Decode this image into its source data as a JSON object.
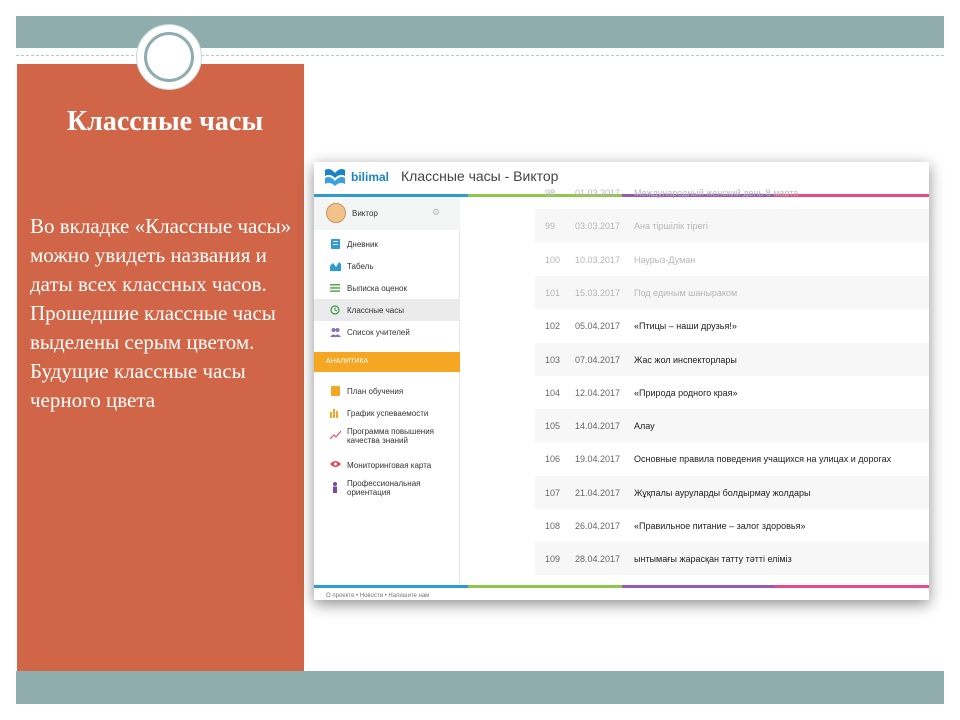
{
  "slide": {
    "title": "Классные часы",
    "body": "Во вкладке «Классные часы» можно увидеть названия и даты всех классных часов. Прошедшие классные часы выделены серым цветом. Будущие классные часы черного цвета"
  },
  "colors": {
    "frame_bar": "#8fadad",
    "left_panel": "#d06548",
    "analytics_band": "#f5a623",
    "brand": "#1c84c6"
  },
  "app": {
    "logo_text": "bilimal",
    "title": "Классные часы - Виктор",
    "user": {
      "name": "Виктор",
      "avatar_icon": "avatar",
      "settings_icon": "gear-icon"
    },
    "nav_items": [
      {
        "label": "Дневник",
        "icon": "diary-icon",
        "active": false
      },
      {
        "label": "Табель",
        "icon": "chart-icon",
        "active": false
      },
      {
        "label": "Выписка оценок",
        "icon": "list-icon",
        "active": false
      },
      {
        "label": "Классные часы",
        "icon": "clock-icon",
        "active": true
      },
      {
        "label": "Список учителей",
        "icon": "teachers-icon",
        "active": false
      }
    ],
    "analytics_label": "АНАЛИТИКА",
    "analytics_items": [
      {
        "label": "План обучения",
        "icon": "plan-icon"
      },
      {
        "label": "График успеваемости",
        "icon": "bar-chart-icon"
      },
      {
        "label": "Программа повышения качества знаний",
        "icon": "trend-icon"
      },
      {
        "label": "Мониторинговая карта",
        "icon": "eye-icon"
      },
      {
        "label": "Профессиональная ориентация",
        "icon": "person-icon"
      }
    ],
    "rows": [
      {
        "num": "98",
        "date": "01.03.2017",
        "topic": "Международный женский день 8 марта",
        "past": true
      },
      {
        "num": "99",
        "date": "03.03.2017",
        "topic": "Ана тіршілік тірегі",
        "past": true
      },
      {
        "num": "100",
        "date": "10.03.2017",
        "topic": "Наурыз-Думан",
        "past": true
      },
      {
        "num": "101",
        "date": "15.03.2017",
        "topic": "Под единым шаныраком",
        "past": true
      },
      {
        "num": "102",
        "date": "05.04.2017",
        "topic": "«Птицы – наши друзья!»",
        "past": false
      },
      {
        "num": "103",
        "date": "07.04.2017",
        "topic": "Жас жол инспекторлары",
        "past": false
      },
      {
        "num": "104",
        "date": "12.04.2017",
        "topic": "«Природа родного края»",
        "past": false
      },
      {
        "num": "105",
        "date": "14.04.2017",
        "topic": "Алау",
        "past": false
      },
      {
        "num": "106",
        "date": "19.04.2017",
        "topic": "Основные правила поведения учащихся на улицах и дорогах",
        "past": false
      },
      {
        "num": "107",
        "date": "21.04.2017",
        "topic": "Жұқпалы ауруларды болдырмау жолдары",
        "past": false
      },
      {
        "num": "108",
        "date": "26.04.2017",
        "topic": "«Правильное питание – залог здоровья»",
        "past": false
      },
      {
        "num": "109",
        "date": "28.04.2017",
        "topic": "ынтымағы жарасқан татту тәтті еліміз",
        "past": false
      }
    ],
    "footer": "О проекте  •  Новости  •  Напишите нам",
    "stripe_colors": [
      "#2e9bd6",
      "#8fc74a",
      "#9b59b6",
      "#e84a8a"
    ]
  }
}
